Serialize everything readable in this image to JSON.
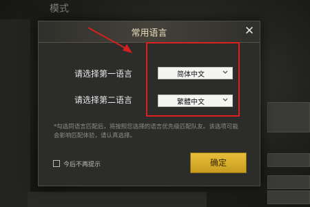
{
  "background": {
    "title": "模式"
  },
  "dialog": {
    "title": "常用语言",
    "close_icon": "close-icon",
    "first_language_label": "请选择第一语言",
    "first_language_value": "简体中文",
    "second_language_label": "请选择第二语言",
    "second_language_value": "繁體中文",
    "notice_line1": "*勾选同语言匹配后，将按照您选择的语言优先级匹配队友。该选项可能",
    "notice_line2": "会影响匹配体验，请认真选择。",
    "dont_show_label": "今后不再提示",
    "confirm_label": "确定"
  },
  "colors": {
    "accent_gold": "#d9b02e",
    "highlight_red": "#e02020",
    "arrow_red": "#d62020"
  }
}
